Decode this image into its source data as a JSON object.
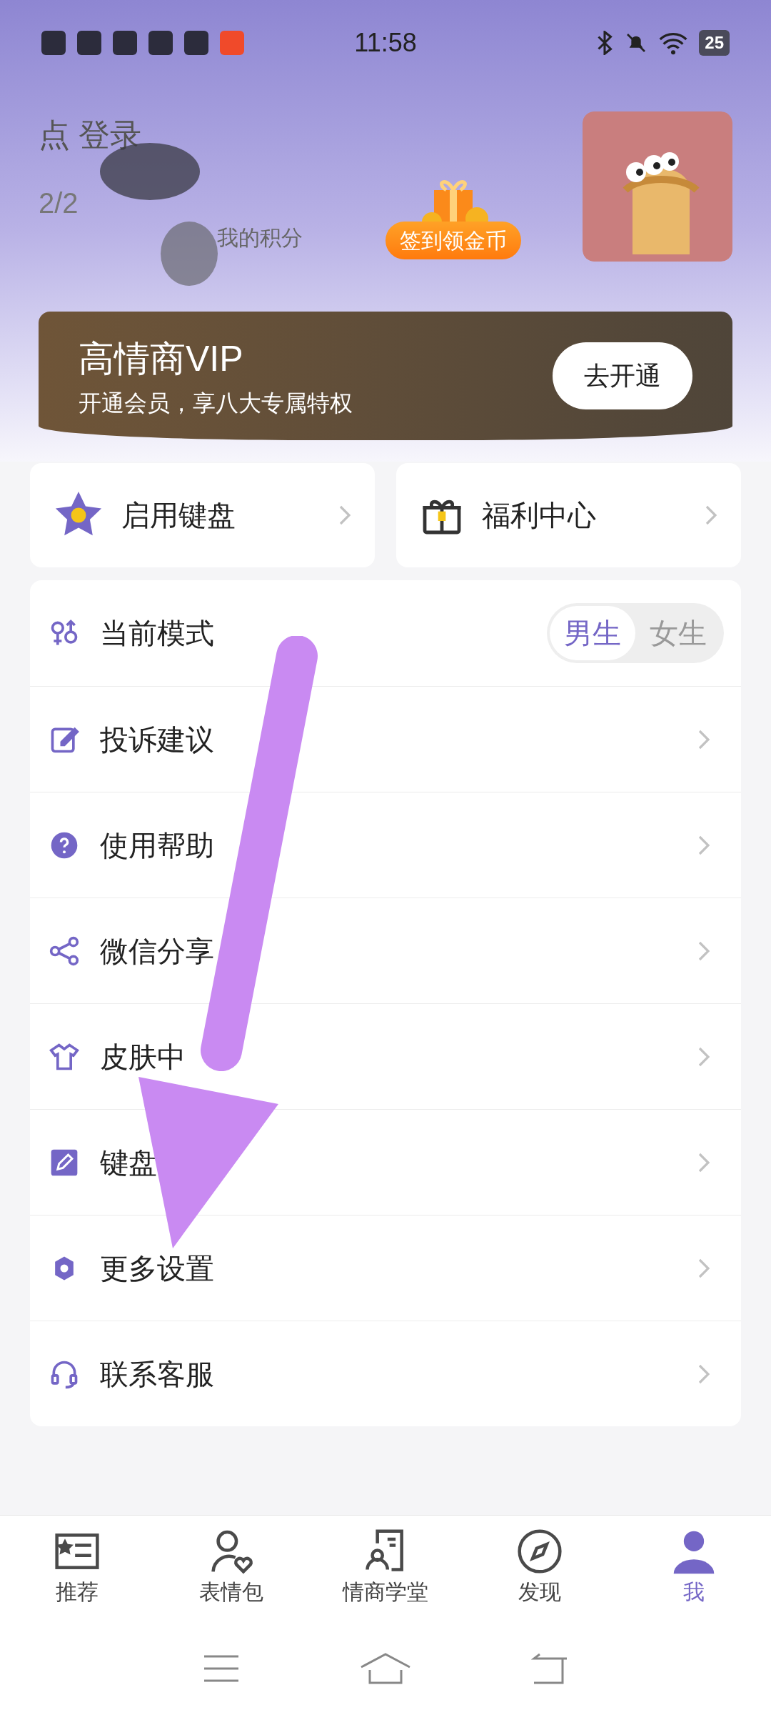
{
  "status_bar": {
    "time": "11:58",
    "battery": "25"
  },
  "profile": {
    "name": "点 登录",
    "stat_value": "2/2",
    "points_label": "我的积分",
    "checkin_label": "签到领金币"
  },
  "vip": {
    "title": "高情商VIP",
    "subtitle": "开通会员，享八大专属特权",
    "button": "去开通"
  },
  "shortcuts": [
    {
      "kind": "keyboard",
      "label": "启用键盘"
    },
    {
      "kind": "gift",
      "label": "福利中心"
    }
  ],
  "menu": [
    {
      "kind": "mode",
      "label": "当前模式",
      "options": [
        {
          "label": "男生",
          "selected": true
        },
        {
          "label": "女生",
          "selected": false
        }
      ]
    },
    {
      "kind": "link",
      "label": "投诉建议"
    },
    {
      "kind": "link",
      "label": "使用帮助"
    },
    {
      "kind": "link",
      "label": "微信分享"
    },
    {
      "kind": "link",
      "label": "皮肤中"
    },
    {
      "kind": "link",
      "label": "键盘"
    },
    {
      "kind": "link",
      "label": "更多设置"
    },
    {
      "kind": "link",
      "label": "联系客服"
    }
  ],
  "tab_bar": [
    {
      "label": "推荐",
      "selected": false
    },
    {
      "label": "表情包",
      "selected": false
    },
    {
      "label": "情商学堂",
      "selected": false
    },
    {
      "label": "发现",
      "selected": false
    },
    {
      "label": "我",
      "selected": true
    }
  ]
}
